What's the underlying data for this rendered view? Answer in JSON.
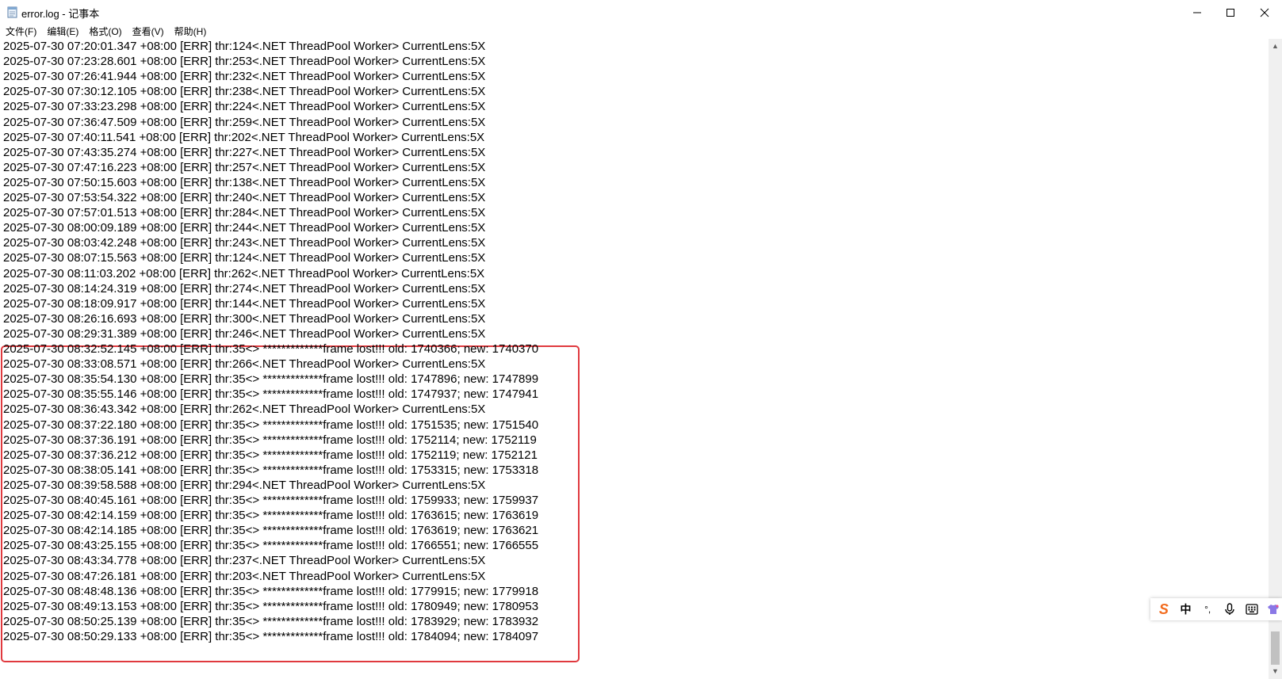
{
  "window": {
    "title": "error.log - 记事本",
    "controls": {
      "minimize": "—",
      "maximize": "☐",
      "close": "✕"
    }
  },
  "menu": [
    "文件(F)",
    "编辑(E)",
    "格式(O)",
    "查看(V)",
    "帮助(H)"
  ],
  "lines": [
    "2025-07-30 07:20:01.347 +08:00 [ERR] thr:124<.NET ThreadPool Worker> CurrentLens:5X",
    "2025-07-30 07:23:28.601 +08:00 [ERR] thr:253<.NET ThreadPool Worker> CurrentLens:5X",
    "2025-07-30 07:26:41.944 +08:00 [ERR] thr:232<.NET ThreadPool Worker> CurrentLens:5X",
    "2025-07-30 07:30:12.105 +08:00 [ERR] thr:238<.NET ThreadPool Worker> CurrentLens:5X",
    "2025-07-30 07:33:23.298 +08:00 [ERR] thr:224<.NET ThreadPool Worker> CurrentLens:5X",
    "2025-07-30 07:36:47.509 +08:00 [ERR] thr:259<.NET ThreadPool Worker> CurrentLens:5X",
    "2025-07-30 07:40:11.541 +08:00 [ERR] thr:202<.NET ThreadPool Worker> CurrentLens:5X",
    "2025-07-30 07:43:35.274 +08:00 [ERR] thr:227<.NET ThreadPool Worker> CurrentLens:5X",
    "2025-07-30 07:47:16.223 +08:00 [ERR] thr:257<.NET ThreadPool Worker> CurrentLens:5X",
    "2025-07-30 07:50:15.603 +08:00 [ERR] thr:138<.NET ThreadPool Worker> CurrentLens:5X",
    "2025-07-30 07:53:54.322 +08:00 [ERR] thr:240<.NET ThreadPool Worker> CurrentLens:5X",
    "2025-07-30 07:57:01.513 +08:00 [ERR] thr:284<.NET ThreadPool Worker> CurrentLens:5X",
    "2025-07-30 08:00:09.189 +08:00 [ERR] thr:244<.NET ThreadPool Worker> CurrentLens:5X",
    "2025-07-30 08:03:42.248 +08:00 [ERR] thr:243<.NET ThreadPool Worker> CurrentLens:5X",
    "2025-07-30 08:07:15.563 +08:00 [ERR] thr:124<.NET ThreadPool Worker> CurrentLens:5X",
    "2025-07-30 08:11:03.202 +08:00 [ERR] thr:262<.NET ThreadPool Worker> CurrentLens:5X",
    "2025-07-30 08:14:24.319 +08:00 [ERR] thr:274<.NET ThreadPool Worker> CurrentLens:5X",
    "2025-07-30 08:18:09.917 +08:00 [ERR] thr:144<.NET ThreadPool Worker> CurrentLens:5X",
    "2025-07-30 08:26:16.693 +08:00 [ERR] thr:300<.NET ThreadPool Worker> CurrentLens:5X",
    "2025-07-30 08:29:31.389 +08:00 [ERR] thr:246<.NET ThreadPool Worker> CurrentLens:5X",
    "2025-07-30 08:32:52.145 +08:00 [ERR] thr:35<> *************frame lost!!! old: 1740366; new: 1740370",
    "2025-07-30 08:33:08.571 +08:00 [ERR] thr:266<.NET ThreadPool Worker> CurrentLens:5X",
    "2025-07-30 08:35:54.130 +08:00 [ERR] thr:35<> *************frame lost!!! old: 1747896; new: 1747899",
    "2025-07-30 08:35:55.146 +08:00 [ERR] thr:35<> *************frame lost!!! old: 1747937; new: 1747941",
    "2025-07-30 08:36:43.342 +08:00 [ERR] thr:262<.NET ThreadPool Worker> CurrentLens:5X",
    "2025-07-30 08:37:22.180 +08:00 [ERR] thr:35<> *************frame lost!!! old: 1751535; new: 1751540",
    "2025-07-30 08:37:36.191 +08:00 [ERR] thr:35<> *************frame lost!!! old: 1752114; new: 1752119",
    "2025-07-30 08:37:36.212 +08:00 [ERR] thr:35<> *************frame lost!!! old: 1752119; new: 1752121",
    "2025-07-30 08:38:05.141 +08:00 [ERR] thr:35<> *************frame lost!!! old: 1753315; new: 1753318",
    "2025-07-30 08:39:58.588 +08:00 [ERR] thr:294<.NET ThreadPool Worker> CurrentLens:5X",
    "2025-07-30 08:40:45.161 +08:00 [ERR] thr:35<> *************frame lost!!! old: 1759933; new: 1759937",
    "2025-07-30 08:42:14.159 +08:00 [ERR] thr:35<> *************frame lost!!! old: 1763615; new: 1763619",
    "2025-07-30 08:42:14.185 +08:00 [ERR] thr:35<> *************frame lost!!! old: 1763619; new: 1763621",
    "2025-07-30 08:43:25.155 +08:00 [ERR] thr:35<> *************frame lost!!! old: 1766551; new: 1766555",
    "2025-07-30 08:43:34.778 +08:00 [ERR] thr:237<.NET ThreadPool Worker> CurrentLens:5X",
    "2025-07-30 08:47:26.181 +08:00 [ERR] thr:203<.NET ThreadPool Worker> CurrentLens:5X",
    "2025-07-30 08:48:48.136 +08:00 [ERR] thr:35<> *************frame lost!!! old: 1779915; new: 1779918",
    "2025-07-30 08:49:13.153 +08:00 [ERR] thr:35<> *************frame lost!!! old: 1780949; new: 1780953",
    "2025-07-30 08:50:25.139 +08:00 [ERR] thr:35<> *************frame lost!!! old: 1783929; new: 1783932",
    "2025-07-30 08:50:29.133 +08:00 [ERR] thr:35<> *************frame lost!!! old: 1784094; new: 1784097"
  ],
  "ime": {
    "logo": "S",
    "mode": "中",
    "punct": "°,",
    "mic": "mic-icon",
    "keyboard": "keyboard-icon",
    "skin": "shirt-icon"
  },
  "colors": {
    "highlight_border": "#e0393e",
    "ime_logo": "#f26b1d"
  }
}
